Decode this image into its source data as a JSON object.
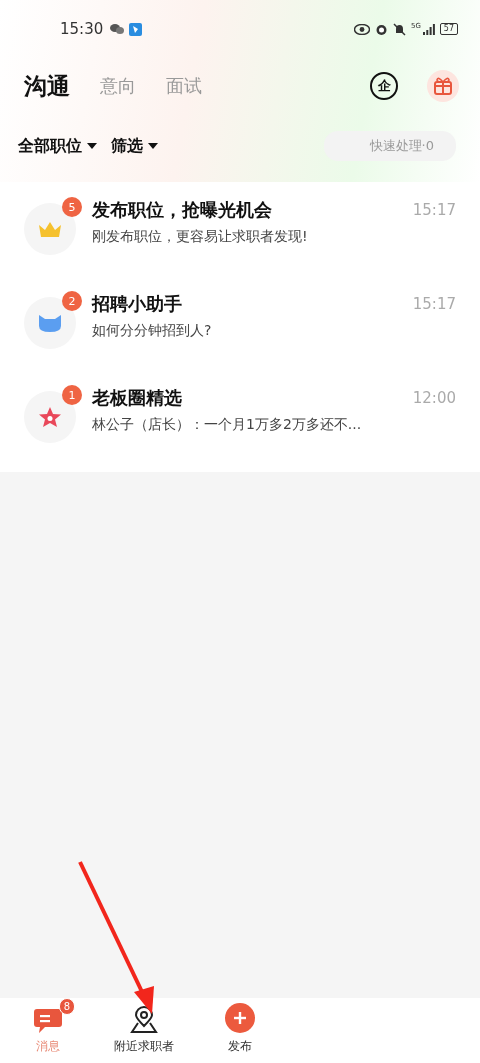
{
  "status_bar": {
    "time": "15:30",
    "network": "5G",
    "battery": "57"
  },
  "tabs": [
    {
      "label": "沟通",
      "selected": true
    },
    {
      "label": "意向",
      "selected": false
    },
    {
      "label": "面试",
      "selected": false
    }
  ],
  "header_icon_label": "企",
  "filters": [
    {
      "label": "全部职位"
    },
    {
      "label": "筛选"
    }
  ],
  "quick_action": {
    "label": "快速处理·0",
    "disabled": true
  },
  "conversations": [
    {
      "kind": "crown",
      "badge": "5",
      "title": "发布职位，抢曝光机会",
      "time": "15:17",
      "preview": "刚发布职位，更容易让求职者发现!"
    },
    {
      "kind": "cat",
      "badge": "2",
      "title": "招聘小助手",
      "time": "15:17",
      "preview": "如何分分钟招到人?"
    },
    {
      "kind": "star",
      "badge": "1",
      "title": "老板圈精选",
      "time": "12:00",
      "preview": "林公子（店长）：一个月1万多2万多还不..."
    }
  ],
  "bottom_nav": [
    {
      "kind": "chat",
      "label": "消息",
      "badge": "8",
      "selected": true
    },
    {
      "kind": "location",
      "label": "附近求职者",
      "selected": false
    },
    {
      "kind": "publish",
      "label": "发布",
      "selected": false
    }
  ]
}
